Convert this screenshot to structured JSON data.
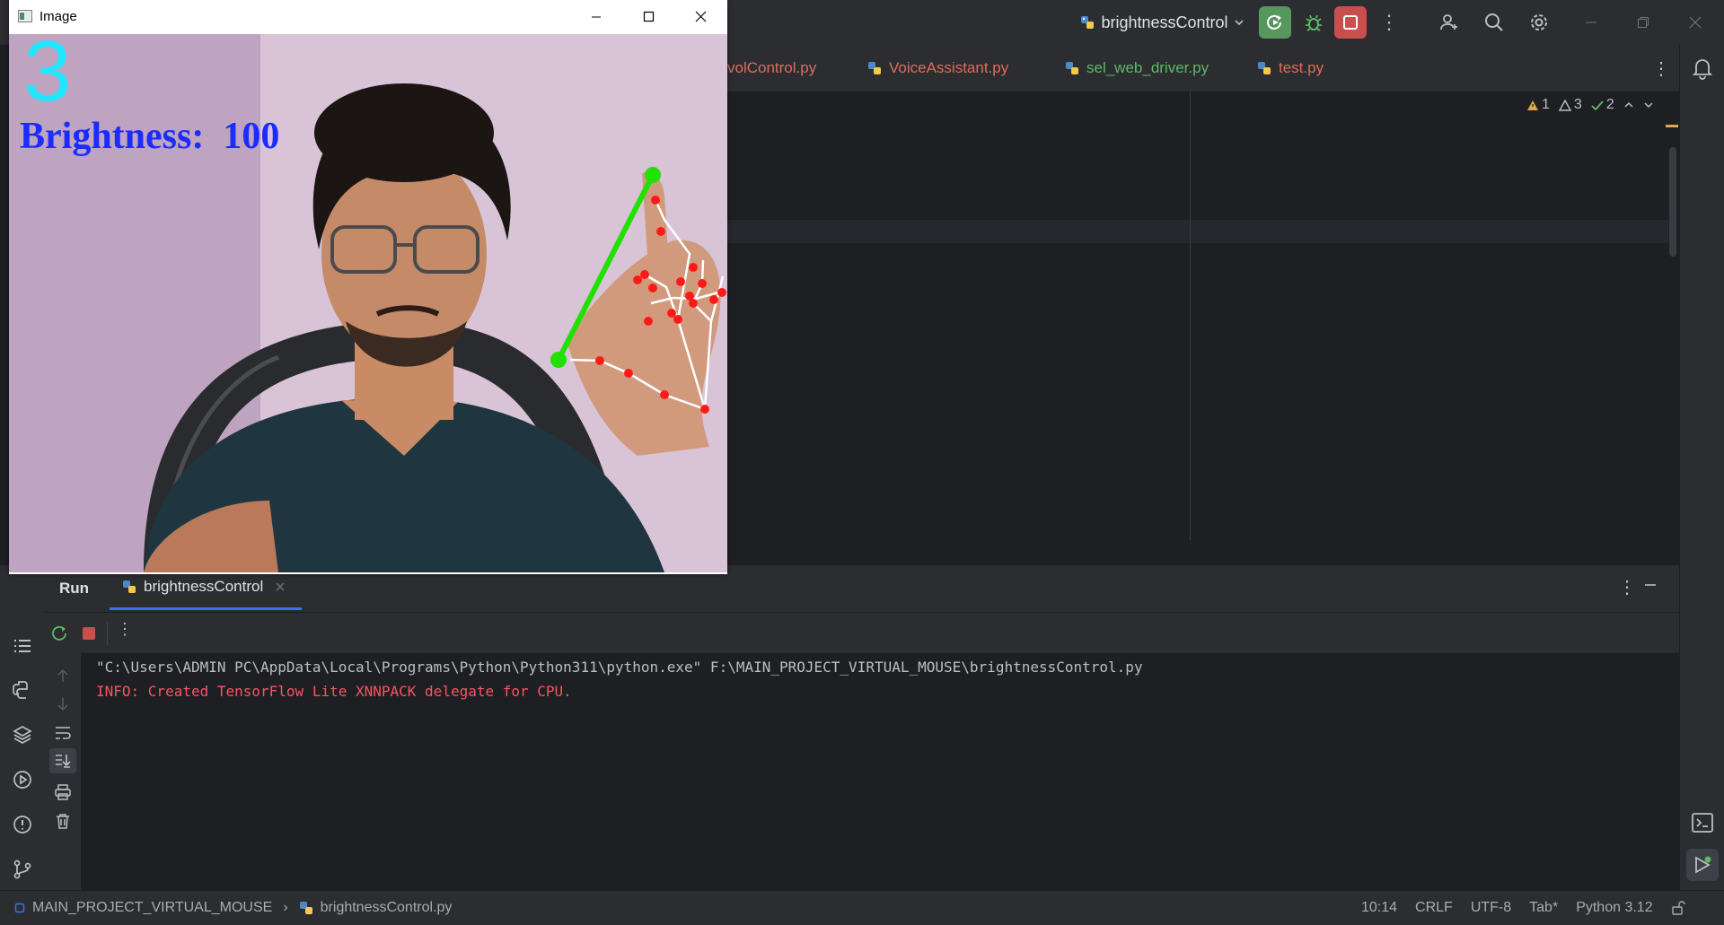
{
  "titlebar": {
    "run_config": "brightnessControl",
    "colors": {
      "run_green": "#57965c",
      "stop_red": "#c94f4f",
      "bug_green": "#5fb865"
    }
  },
  "editor": {
    "tabs": [
      {
        "label": "volControl.py",
        "color": "#e06c5a"
      },
      {
        "label": "VoiceAssistant.py",
        "color": "#e06c5a"
      },
      {
        "label": "sel_web_driver.py",
        "color": "#5fb865"
      },
      {
        "label": "test.py",
        "color": "#e06c5a"
      }
    ],
    "inspections": {
      "warnings_strong": "1",
      "warnings_weak": "3",
      "typos": "2"
    }
  },
  "run_panel": {
    "title": "Run",
    "tab_label": "brightnessControl",
    "console": [
      {
        "text": "\"C:\\Users\\ADMIN PC\\AppData\\Local\\Programs\\Python\\Python311\\python.exe\" F:\\MAIN_PROJECT_VIRTUAL_MOUSE\\brightnessControl.py",
        "color": "#bcbec4"
      },
      {
        "text": "INFO: Created TensorFlow Lite XNNPACK delegate for CPU.",
        "color": "#f75464"
      }
    ]
  },
  "statusbar": {
    "project": "MAIN_PROJECT_VIRTUAL_MOUSE",
    "file": "brightnessControl.py",
    "position": "10:14",
    "line_sep": "CRLF",
    "encoding": "UTF-8",
    "indent": "Tab*",
    "interpreter": "Python 3.12"
  },
  "image_window": {
    "title": "Image",
    "finger_count": "3",
    "brightness_text": "Brightness:  100"
  }
}
